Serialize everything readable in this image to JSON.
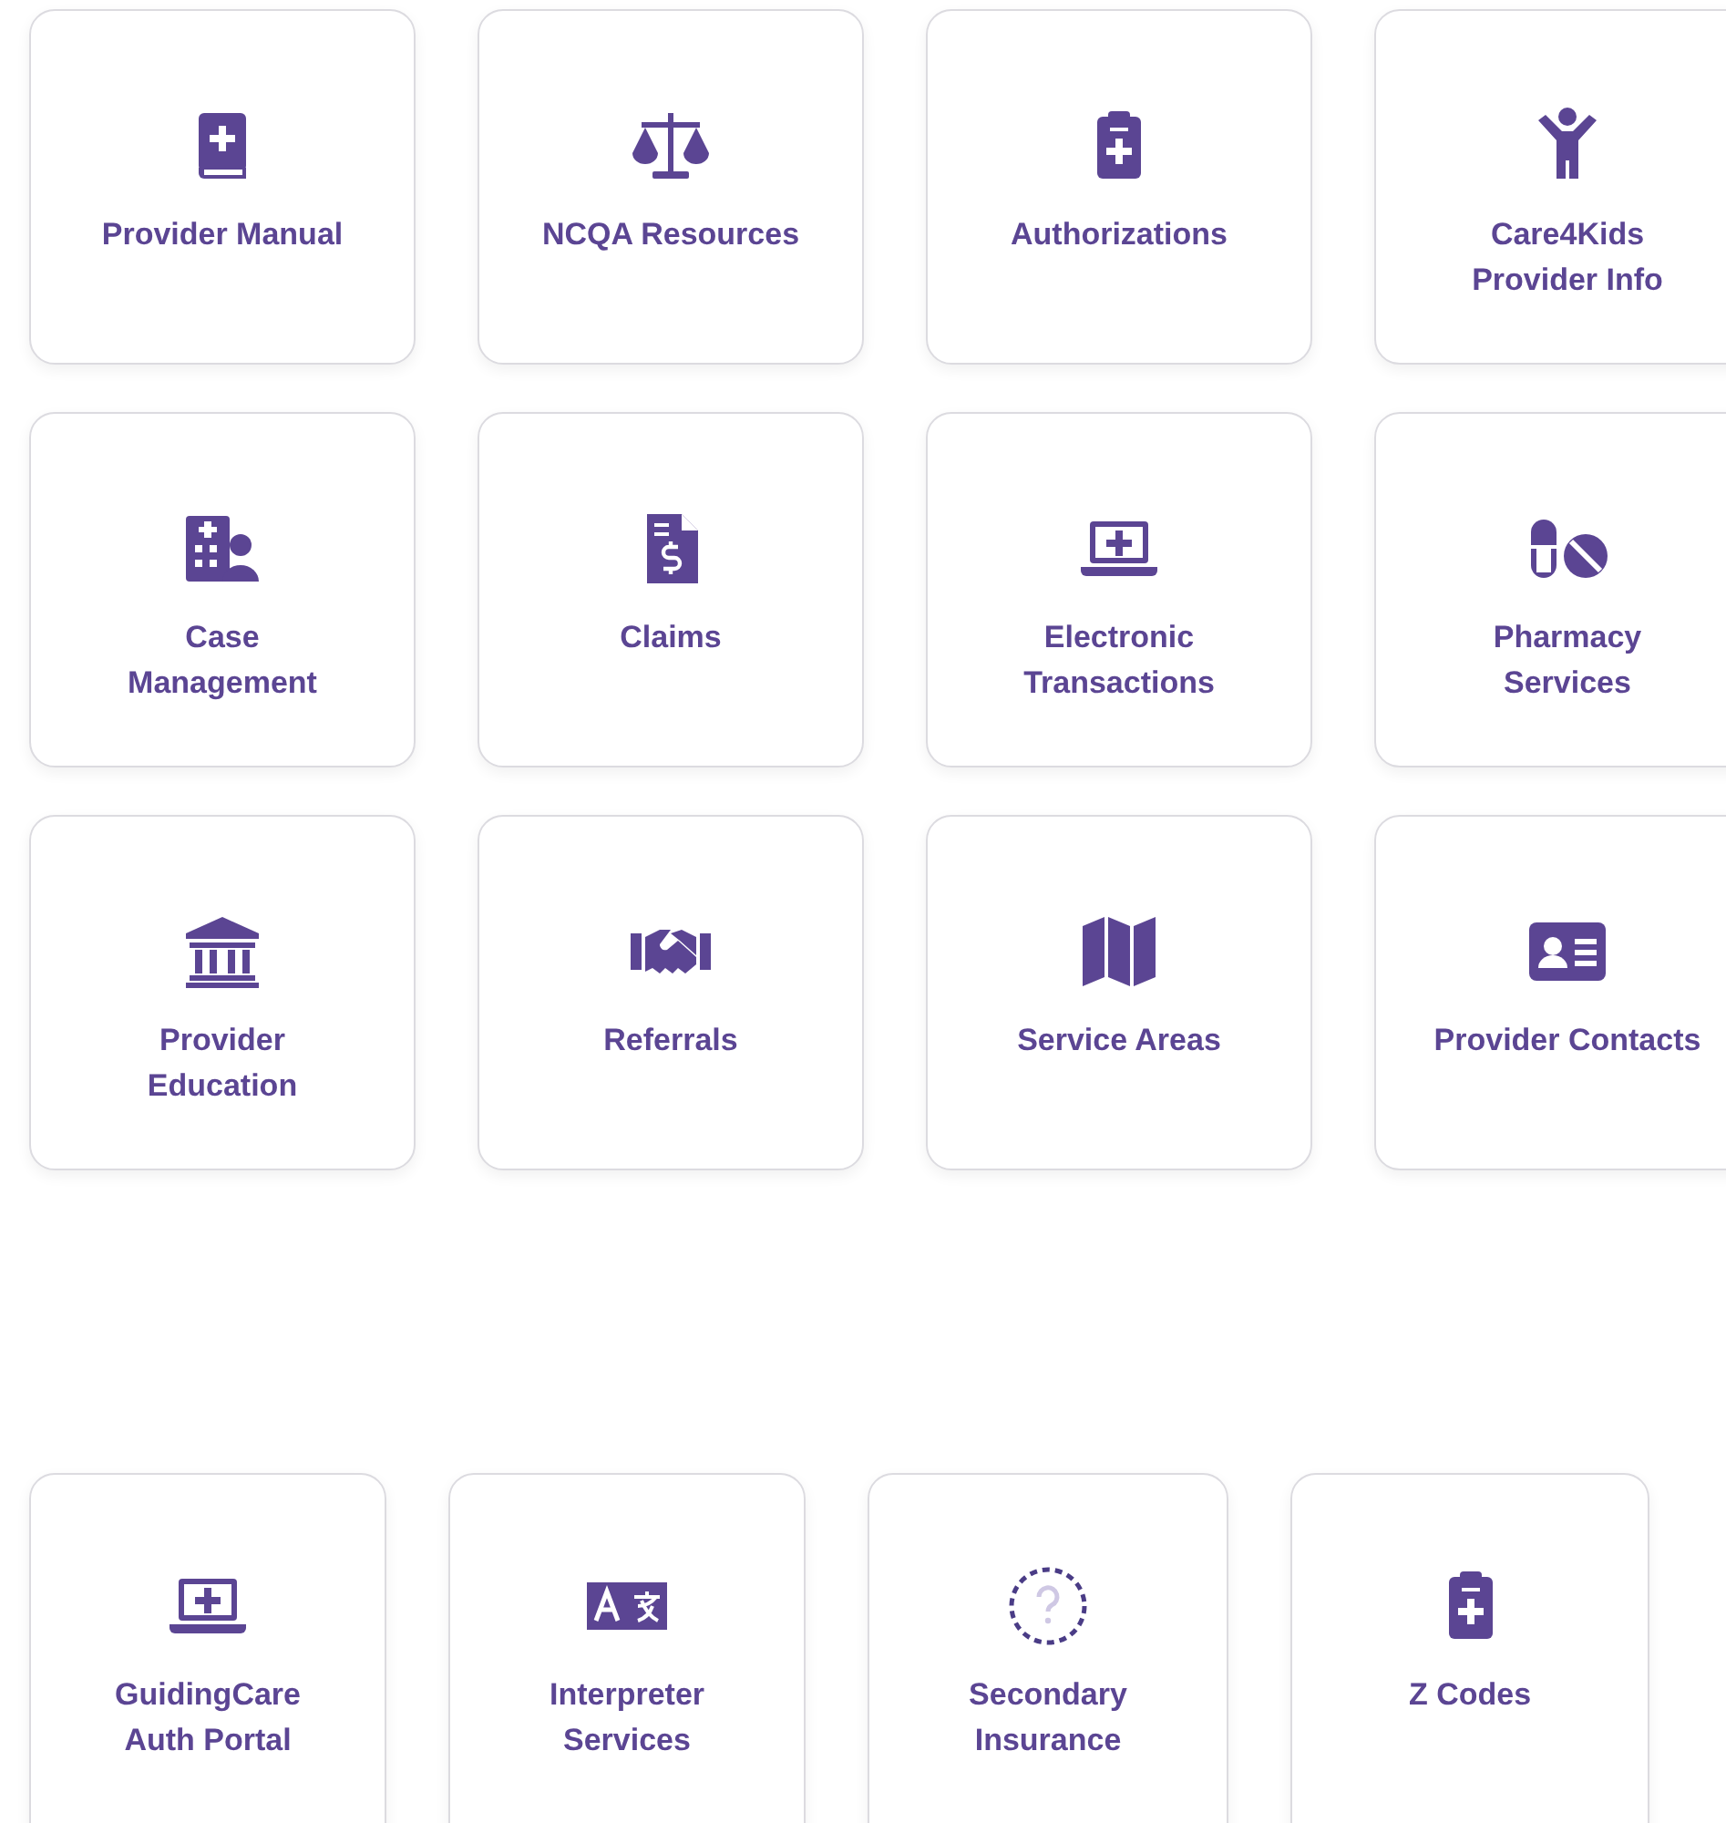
{
  "top_tiles": [
    {
      "label": "Provider Manual"
    },
    {
      "label": "NCQA Resources"
    },
    {
      "label": "Authorizations"
    },
    {
      "label": "Care4Kids\nProvider Info"
    },
    {
      "label": "Case\nManagement"
    },
    {
      "label": "Claims"
    },
    {
      "label": "Electronic\nTransactions"
    },
    {
      "label": "Pharmacy\nServices"
    },
    {
      "label": "Provider\nEducation"
    },
    {
      "label": "Referrals"
    },
    {
      "label": "Service Areas"
    },
    {
      "label": "Provider Contacts"
    }
  ],
  "bottom_tiles": [
    {
      "label": "GuidingCare\nAuth Portal"
    },
    {
      "label": "Interpreter\nServices"
    },
    {
      "label": "Secondary\nInsurance"
    },
    {
      "label": "Z Codes"
    }
  ]
}
